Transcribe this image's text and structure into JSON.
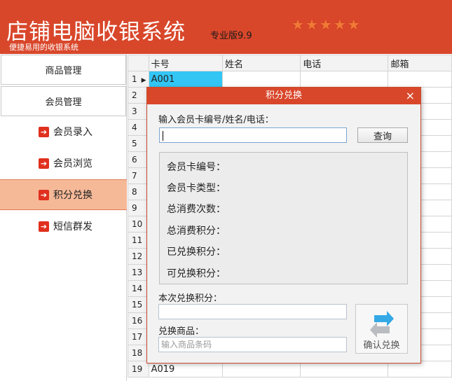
{
  "header": {
    "title": "店铺电脑收银系统",
    "edition": "专业版9.9",
    "subtitle": "便捷易用的收银系统",
    "stars": [
      "★",
      "★",
      "★",
      "★",
      "★"
    ]
  },
  "sidebar": {
    "main_items": [
      {
        "label": "商品管理"
      },
      {
        "label": "会员管理"
      }
    ],
    "sub_items": [
      {
        "label": "会员录入",
        "icon": "arrow-right-icon"
      },
      {
        "label": "会员浏览",
        "icon": "arrow-right-icon"
      },
      {
        "label": "积分兑换",
        "icon": "arrow-right-icon",
        "active": true
      },
      {
        "label": "短信群发",
        "icon": "arrow-right-icon"
      }
    ]
  },
  "grid": {
    "columns": [
      "卡号",
      "姓名",
      "电话",
      "邮箱"
    ],
    "rows": [
      {
        "num": "1",
        "card": "A001"
      },
      {
        "num": "2",
        "card": ""
      },
      {
        "num": "3",
        "card": ""
      },
      {
        "num": "4",
        "card": ""
      },
      {
        "num": "5",
        "card": ""
      },
      {
        "num": "6",
        "card": ""
      },
      {
        "num": "7",
        "card": ""
      },
      {
        "num": "8",
        "card": ""
      },
      {
        "num": "9",
        "card": ""
      },
      {
        "num": "10",
        "card": ""
      },
      {
        "num": "11",
        "card": ""
      },
      {
        "num": "12",
        "card": ""
      },
      {
        "num": "13",
        "card": ""
      },
      {
        "num": "14",
        "card": ""
      },
      {
        "num": "15",
        "card": ""
      },
      {
        "num": "16",
        "card": ""
      },
      {
        "num": "17",
        "card": ""
      },
      {
        "num": "18",
        "card": ""
      },
      {
        "num": "19",
        "card": "A019"
      }
    ]
  },
  "dialog": {
    "title": "积分兑换",
    "close": "×",
    "search_label": "输入会员卡编号/姓名/电话：",
    "search_value": "",
    "query_button": "查询",
    "info": {
      "card_no": "会员卡编号：",
      "card_type": "会员卡类型：",
      "total_times": "总消费次数：",
      "total_points": "总消费积分：",
      "redeemed_points": "已兑换积分：",
      "available_points": "可兑换积分："
    },
    "redeem_label": "本次兑换积分：",
    "redeem_value": "",
    "goods_label": "兑换商品：",
    "goods_placeholder": "输入商品条码",
    "confirm_button": "确认兑换"
  },
  "colors": {
    "brand": "#d9472b",
    "selected_cell": "#33c6f5",
    "active_nav": "#f6b998"
  }
}
